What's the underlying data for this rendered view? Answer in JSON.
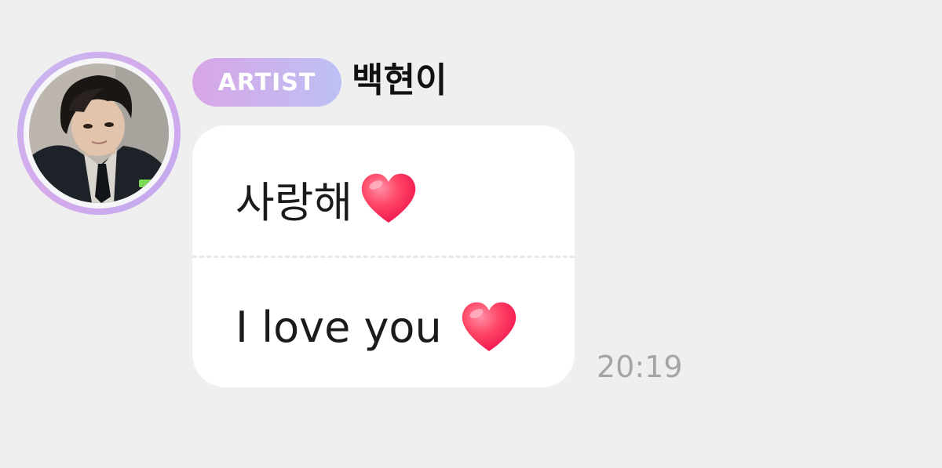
{
  "message": {
    "badge_label": "ARTIST",
    "sender_name": "백현이",
    "text_korean": "사랑해",
    "text_english": "I love you",
    "heart_icon": "red-heart-emoji",
    "timestamp": "20:19"
  },
  "colors": {
    "background": "#efeff0",
    "bubble": "#ffffff",
    "badge_gradient_start": "#d8a6e6",
    "badge_gradient_end": "#bdc0f4",
    "avatar_ring": "#c9b0ef",
    "timestamp": "#a5a5a5",
    "heart": "#ff3b63"
  }
}
